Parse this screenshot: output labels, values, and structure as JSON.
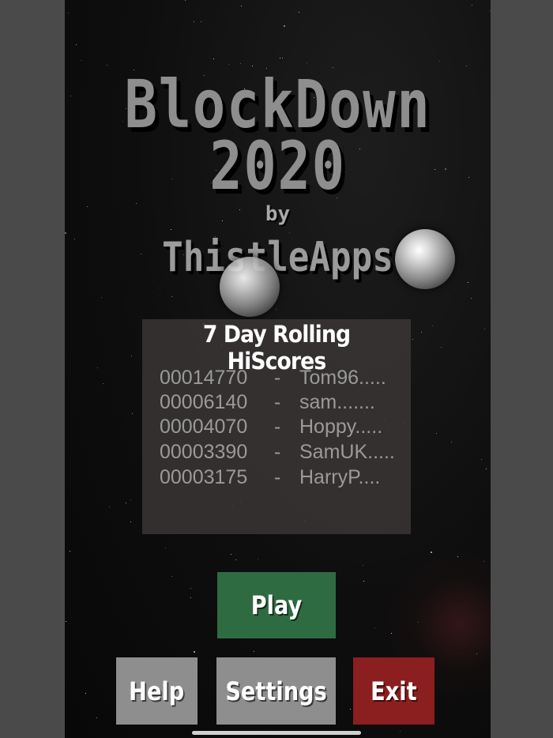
{
  "title": {
    "line1": "BlockDown",
    "line2": "2020",
    "by": "by",
    "author": "ThistleApps"
  },
  "hiscores": {
    "heading": "7 Day Rolling HiScores",
    "separator": "-",
    "rows": [
      {
        "score": "00014770",
        "name": "Tom96....."
      },
      {
        "score": "00006140",
        "name": "sam......."
      },
      {
        "score": "00004070",
        "name": "Hoppy....."
      },
      {
        "score": "00003390",
        "name": "SamUK....."
      },
      {
        "score": "00003175",
        "name": "HarryP...."
      }
    ]
  },
  "buttons": {
    "play": "Play",
    "help": "Help",
    "settings": "Settings",
    "exit": "Exit"
  },
  "colors": {
    "play": "#2f6b41",
    "neutral": "#8e8e8e",
    "exit": "#8b1e1e",
    "title": "#8e8e8e"
  },
  "icons": {
    "ball": "silver-ball-icon"
  }
}
